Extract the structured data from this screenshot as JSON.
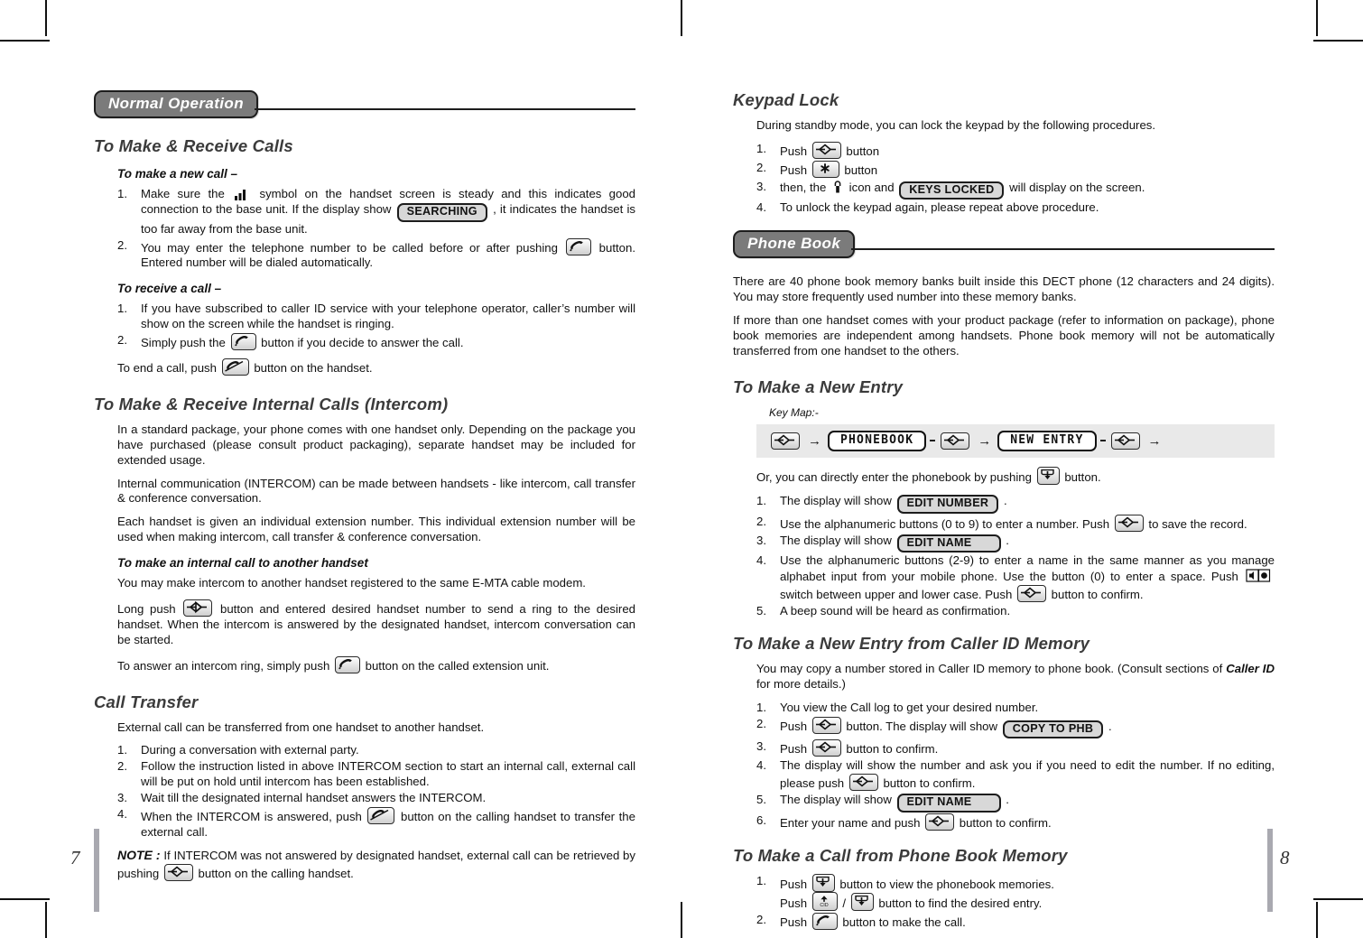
{
  "document": {
    "left_page_number": "7",
    "right_page_number": "8"
  },
  "left_page": {
    "banner": "Normal Operation",
    "sections": [
      {
        "title": "To Make & Receive Calls",
        "sub1": "To make a new call –",
        "step1_a": "Make sure the",
        "step1_b": "symbol on the handset screen is steady and this indicates good connection to the base unit. If the display show",
        "step1_badge": "SEARCHING",
        "step1_c": ", it indicates the handset is too far away from the base unit.",
        "step2_a": "You may enter the telephone number to be called before or after pushing",
        "step2_b": "button. Entered number will be dialed automatically.",
        "sub2": "To receive a call –",
        "rstep1": "If you have subscribed to caller ID service with your telephone operator, caller’s number will show on the screen while the handset is ringing.",
        "rstep2_a": "Simply push the",
        "rstep2_b": "button if you decide to answer the call.",
        "end_a": "To end a call, push",
        "end_b": "button on the handset."
      },
      {
        "title": "To Make & Receive Internal Calls (Intercom)",
        "p1": "In a standard package, your phone comes with one handset only.  Depending on the package you have purchased (please consult product packaging), separate handset may be included for extended usage.",
        "p2": "Internal communication (INTERCOM) can be made between handsets - like intercom, call transfer & conference conversation.",
        "p3": "Each handset is given an individual extension number. This individual extension number will be used when making intercom, call transfer & conference conversation.",
        "sub1": "To make an internal call to another handset",
        "p4": "You may make intercom to another handset registered to the same E-MTA cable modem.",
        "p5_a": "Long push",
        "p5_b": "button and entered desired handset number to send a ring to the desired handset. When the intercom is answered by the designated handset, intercom conversation can be started.",
        "p6_a": "To answer an intercom ring, simply push",
        "p6_b": "button on the called extension unit."
      },
      {
        "title": "Call Transfer",
        "p1": "External call can be transferred from one handset to another handset.",
        "step1": "During a conversation with external party.",
        "step2": "Follow the instruction listed in above INTERCOM section to start an internal call, external call will be put on hold until intercom has been established.",
        "step3": "Wait till the designated internal handset answers the INTERCOM.",
        "step4_a": "When the INTERCOM is answered, push",
        "step4_b": "button on the calling handset to transfer the external call.",
        "note_label": "NOTE :",
        "note_a": "If INTERCOM was not answered by designated handset, external call can be retrieved by pushing",
        "note_b": "button on the calling handset."
      }
    ]
  },
  "right_page": {
    "keypad_lock": {
      "title": "Keypad Lock",
      "intro": "During standby mode, you can lock the keypad by the following procedures.",
      "step1_a": "Push",
      "step1_b": "button",
      "step2_a": "Push",
      "step2_b": "button",
      "step3_a": "then, the",
      "step3_b": "icon and",
      "step3_badge": "KEYS LOCKED",
      "step3_c": "will display on the screen.",
      "step4": "To unlock the keypad again, please repeat above procedure."
    },
    "banner": "Phone Book",
    "phone_book": {
      "p1": "There are 40 phone book memory banks built inside this DECT phone (12 characters and 24 digits). You may store frequently used number into these memory banks.",
      "p2": "If more than one handset comes with your product package (refer to information on package), phone book memories are independent among handsets. Phone book memory will not be automatically transferred from one handset to the others."
    },
    "new_entry": {
      "title": "To Make a New Entry",
      "keymap_label": "Key Map:-",
      "keymap": {
        "lcd1": "PHONEBOOK",
        "lcd2": "NEW ENTRY"
      },
      "or_a": "Or, you can directly enter the phonebook by pushing",
      "or_b": "button.",
      "step1_a": "The display will show",
      "step1_badge": "EDIT NUMBER",
      "step1_b": ".",
      "step2_a": "Use the alphanumeric buttons (0 to 9) to enter a number. Push",
      "step2_b": "to save the record.",
      "step3_a": "The display will show",
      "step3_badge": "EDIT NAME",
      "step3_b": ".",
      "step4_a": "Use the alphanumeric buttons (2-9) to enter a name in the same manner as you manage alphabet input from your mobile phone. Use the button (0) to enter a space. Push",
      "step4_b": "switch between upper and lower case. Push",
      "step4_c": "button to confirm.",
      "step5": "A beep sound will be heard as confirmation."
    },
    "caller_id_entry": {
      "title": "To Make a New Entry from Caller ID Memory",
      "p1_a": "You may copy a number stored in Caller ID memory to phone book. (Consult sections of",
      "p1_em": "Caller ID",
      "p1_b": "for more details.)",
      "step1": "You view the Call log to get your desired number.",
      "step2_a": "Push",
      "step2_b": "button.  The display will show",
      "step2_badge": "COPY TO PHB",
      "step2_c": ".",
      "step3_a": "Push",
      "step3_b": "button to confirm.",
      "step4_a": "The display will show the number and ask you if you need to edit the number. If no editing, please push",
      "step4_b": "button to confirm.",
      "step5_a": "The display will show",
      "step5_badge": "EDIT NAME",
      "step5_b": ".",
      "step6_a": "Enter your name and push",
      "step6_b": "button to confirm."
    },
    "call_from_pb": {
      "title": "To Make a Call from Phone Book Memory",
      "step1_a": "Push",
      "step1_b": "button to view the phonebook memories.",
      "step1_c": "Push",
      "step1_d": "/",
      "step1_e": "button to find the desired entry.",
      "step2_a": "Push",
      "step2_b": "button to make the call."
    }
  },
  "icons": {
    "signal": "signal-bars-icon",
    "menu_key": "menu-arrow-key-icon",
    "talk_key": "talk-handset-key-icon",
    "end_key": "end-call-key-icon",
    "star_key": "star-key-icon",
    "lock": "padlock-icon",
    "phonebook_down_key": "phonebook-down-key-icon",
    "cid_up_key": "cid-up-key-icon",
    "speaker_key": "speaker-key-icon"
  },
  "colors": {
    "banner_fill": "#7b7b7b",
    "banner_text": "#ffffff",
    "lcd_fill": "#d8d8d8",
    "keymap_strip": "#e9e9e9",
    "heading": "#3b3b3b"
  }
}
